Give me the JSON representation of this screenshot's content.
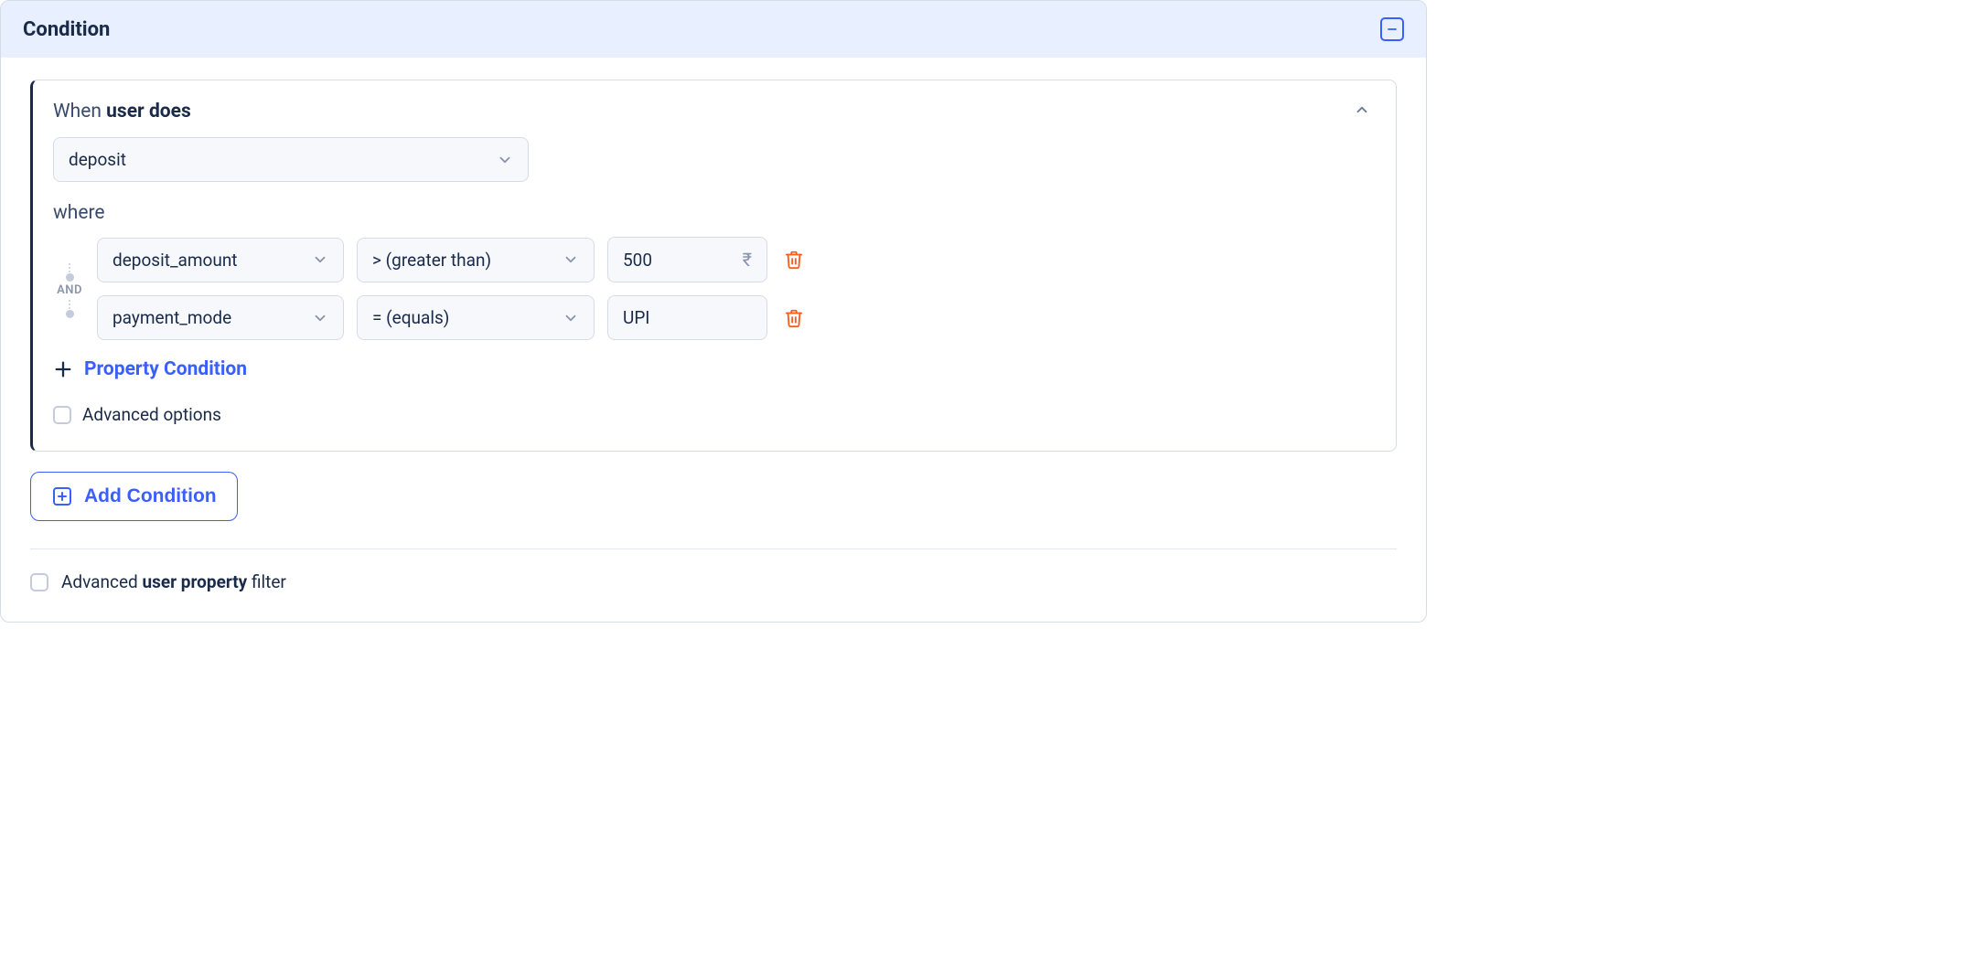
{
  "panel": {
    "title": "Condition"
  },
  "card": {
    "when_prefix": "When ",
    "when_bold": "user does",
    "event": "deposit",
    "where_label": "where",
    "logic_op": "AND",
    "filters": [
      {
        "property": "deposit_amount",
        "operator": "> (greater than)",
        "value": "500",
        "unit": "₹"
      },
      {
        "property": "payment_mode",
        "operator": "= (equals)",
        "value": "UPI",
        "unit": ""
      }
    ],
    "add_property_label": "Property Condition",
    "advanced_options_label": "Advanced options"
  },
  "add_condition_label": "Add Condition",
  "adv_user_prop": {
    "prefix": "Advanced ",
    "bold": "user property",
    "suffix": " filter"
  }
}
